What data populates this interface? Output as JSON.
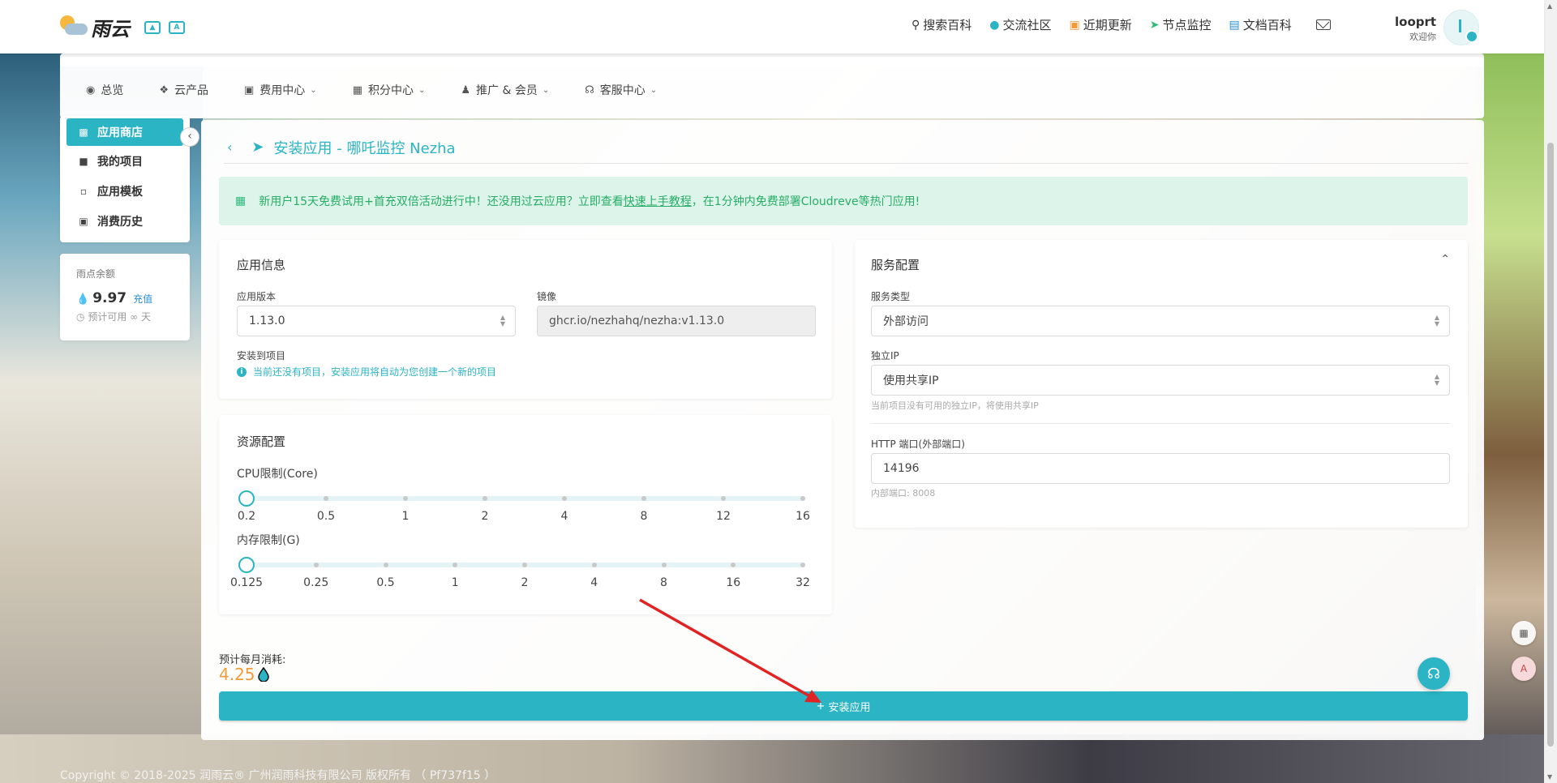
{
  "brand": {
    "logo_text": "雨云",
    "badge1_icon": "image-icon",
    "badge2_icon": "translate-icon"
  },
  "topnav": {
    "links": [
      {
        "icon": "search-icon",
        "label": "搜索百科"
      },
      {
        "icon": "qq-icon",
        "label": "交流社区"
      },
      {
        "icon": "news-icon",
        "label": "近期更新"
      },
      {
        "icon": "send-icon",
        "label": "节点监控"
      },
      {
        "icon": "book-icon",
        "label": "文档百科"
      }
    ],
    "user_name": "looprt",
    "user_greeting": "欢迎你"
  },
  "menu": {
    "items": [
      {
        "icon": "dashboard-icon",
        "label": "总览",
        "has_dropdown": false
      },
      {
        "icon": "cubes-icon",
        "label": "云产品",
        "has_dropdown": false
      },
      {
        "icon": "money-icon",
        "label": "费用中心",
        "has_dropdown": true
      },
      {
        "icon": "gift-icon",
        "label": "积分中心",
        "has_dropdown": true
      },
      {
        "icon": "users-icon",
        "label": "推广 & 会员",
        "has_dropdown": true
      },
      {
        "icon": "headset-icon",
        "label": "客服中心",
        "has_dropdown": true
      }
    ]
  },
  "sidebar": {
    "items": [
      {
        "icon": "store-icon",
        "label": "应用商店",
        "active": true
      },
      {
        "icon": "folder-icon",
        "label": "我的项目",
        "active": false
      },
      {
        "icon": "file-icon",
        "label": "应用模板",
        "active": false
      },
      {
        "icon": "money-icon",
        "label": "消费历史",
        "active": false
      }
    ],
    "balance": {
      "label": "雨点余额",
      "value": "9.97",
      "recharge": "充值",
      "estimate_prefix": "预计可用",
      "estimate_value": "∞",
      "estimate_suffix": "天"
    }
  },
  "page": {
    "title": "安装应用 - 哪吒监控 Nezha",
    "alert_text_1": "新用户15天免费试用+首充双倍活动进行中！还没用过云应用？立即查看",
    "alert_link": "快速上手教程",
    "alert_text_2": "，在1分钟内免费部署Cloudreve等热门应用!"
  },
  "app_info": {
    "title": "应用信息",
    "version_label": "应用版本",
    "version_value": "1.13.0",
    "image_label": "镜像",
    "image_value": "ghcr.io/nezhahq/nezha:v1.13.0",
    "project_label": "安装到项目",
    "project_info": "当前还没有项目，安装应用将自动为您创建一个新的项目"
  },
  "resources": {
    "title": "资源配置",
    "cpu_label": "CPU限制(Core)",
    "cpu_ticks": [
      "0.2",
      "0.5",
      "1",
      "2",
      "4",
      "8",
      "12",
      "16"
    ],
    "cpu_selected_index": 0,
    "mem_label": "内存限制(G)",
    "mem_ticks": [
      "0.125",
      "0.25",
      "0.5",
      "1",
      "2",
      "4",
      "8",
      "16",
      "32"
    ],
    "mem_selected_index": 0
  },
  "service": {
    "title": "服务配置",
    "type_label": "服务类型",
    "type_value": "外部访问",
    "ip_label": "独立IP",
    "ip_value": "使用共享IP",
    "ip_hint": "当前项目没有可用的独立IP，将使用共享IP",
    "port_label": "HTTP 端口(外部端口)",
    "port_value": "14196",
    "internal_port": "内部端口: 8008"
  },
  "cost": {
    "label": "预计每月消耗:",
    "value": "4.25"
  },
  "install_button": "安装应用",
  "footer": "Copyright © 2018-2025 润雨云® 广州润雨科技有限公司 版权所有 （ Pf737f15 ）",
  "colors": {
    "accent": "#2bb4c4",
    "cost": "#f29b38",
    "alert_bg": "#dcf4ea",
    "alert_text": "#27ad66",
    "annotation_arrow": "#e02424"
  }
}
